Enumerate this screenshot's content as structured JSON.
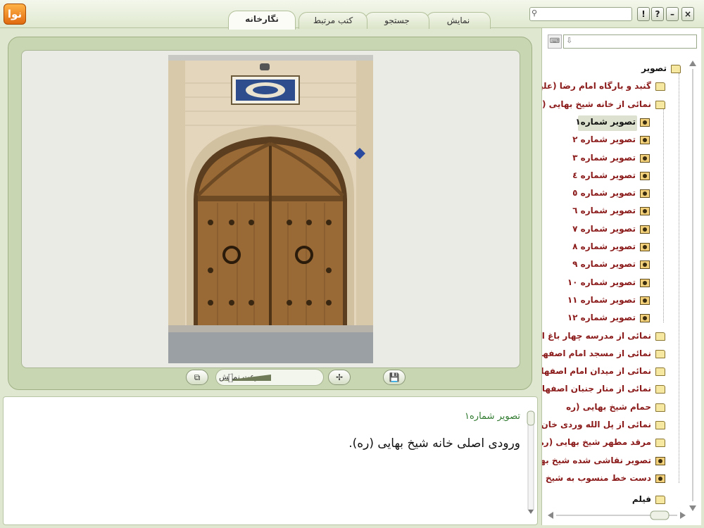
{
  "app": {
    "logo_text": "نوا"
  },
  "tabs": [
    {
      "label": "نگارخانه",
      "active": true
    },
    {
      "label": "کتب مرتبط",
      "active": false
    },
    {
      "label": "جستجو",
      "active": false
    },
    {
      "label": "نمایش",
      "active": false
    }
  ],
  "window_buttons": {
    "help_exclaim": "!",
    "help_question": "?",
    "minimize": "–",
    "close": "×"
  },
  "viewer": {
    "speed_label": "سرعت نمایش"
  },
  "description": {
    "title": "تصویر شماره۱",
    "text": "ورودی اصلی خانه شیخ بهایی (ره)."
  },
  "tree": {
    "root": "تصویر",
    "items": [
      {
        "label": "گنبد و بارگاه امام رضا (علیه ا",
        "type": "folder",
        "color": "red"
      },
      {
        "label": "نمائی از خانه شیخ بهایی (ره",
        "type": "folder-open",
        "color": "red"
      },
      {
        "label": "تصویر شماره۱",
        "type": "image",
        "color": "dark",
        "selected": true
      },
      {
        "label": "تصویر شماره ۲",
        "type": "image",
        "color": "red"
      },
      {
        "label": "تصویر شماره ۳",
        "type": "image",
        "color": "red"
      },
      {
        "label": "تصویر شماره ٤",
        "type": "image",
        "color": "red"
      },
      {
        "label": "تصویر شماره ٥",
        "type": "image",
        "color": "red"
      },
      {
        "label": "تصویر شماره ٦",
        "type": "image",
        "color": "red"
      },
      {
        "label": "تصویر شماره ۷",
        "type": "image",
        "color": "red"
      },
      {
        "label": "تصویر شماره ۸",
        "type": "image",
        "color": "red"
      },
      {
        "label": "تصویر شماره ۹",
        "type": "image",
        "color": "red"
      },
      {
        "label": "تصویر شماره ۱۰",
        "type": "image",
        "color": "red"
      },
      {
        "label": "تصویر شماره ۱۱",
        "type": "image",
        "color": "red"
      },
      {
        "label": "تصویر شماره ۱۲",
        "type": "image",
        "color": "red"
      },
      {
        "label": "نمائی از مدرسه چهار باغ اصفه",
        "type": "folder",
        "color": "red"
      },
      {
        "label": "نمائی از مسجد امام اصفهان",
        "type": "folder",
        "color": "red"
      },
      {
        "label": "نمائی از میدان امام اصفهان",
        "type": "folder",
        "color": "red"
      },
      {
        "label": "نمائی از منار جنبان اصفهان",
        "type": "folder",
        "color": "red"
      },
      {
        "label": "حمام شیخ بهایی (ره",
        "type": "folder",
        "color": "red"
      },
      {
        "label": "نمائی از پل الله وردی خان اص",
        "type": "folder",
        "color": "red"
      },
      {
        "label": "مرقد مطهر شیخ بهایی (ره) د",
        "type": "folder",
        "color": "red"
      },
      {
        "label": "تصویر نقاشی شده شیخ بهایی",
        "type": "image",
        "color": "red"
      },
      {
        "label": "دست خط منسوب به شیخ بهاء",
        "type": "image",
        "color": "red"
      }
    ],
    "film": "فیلم"
  }
}
